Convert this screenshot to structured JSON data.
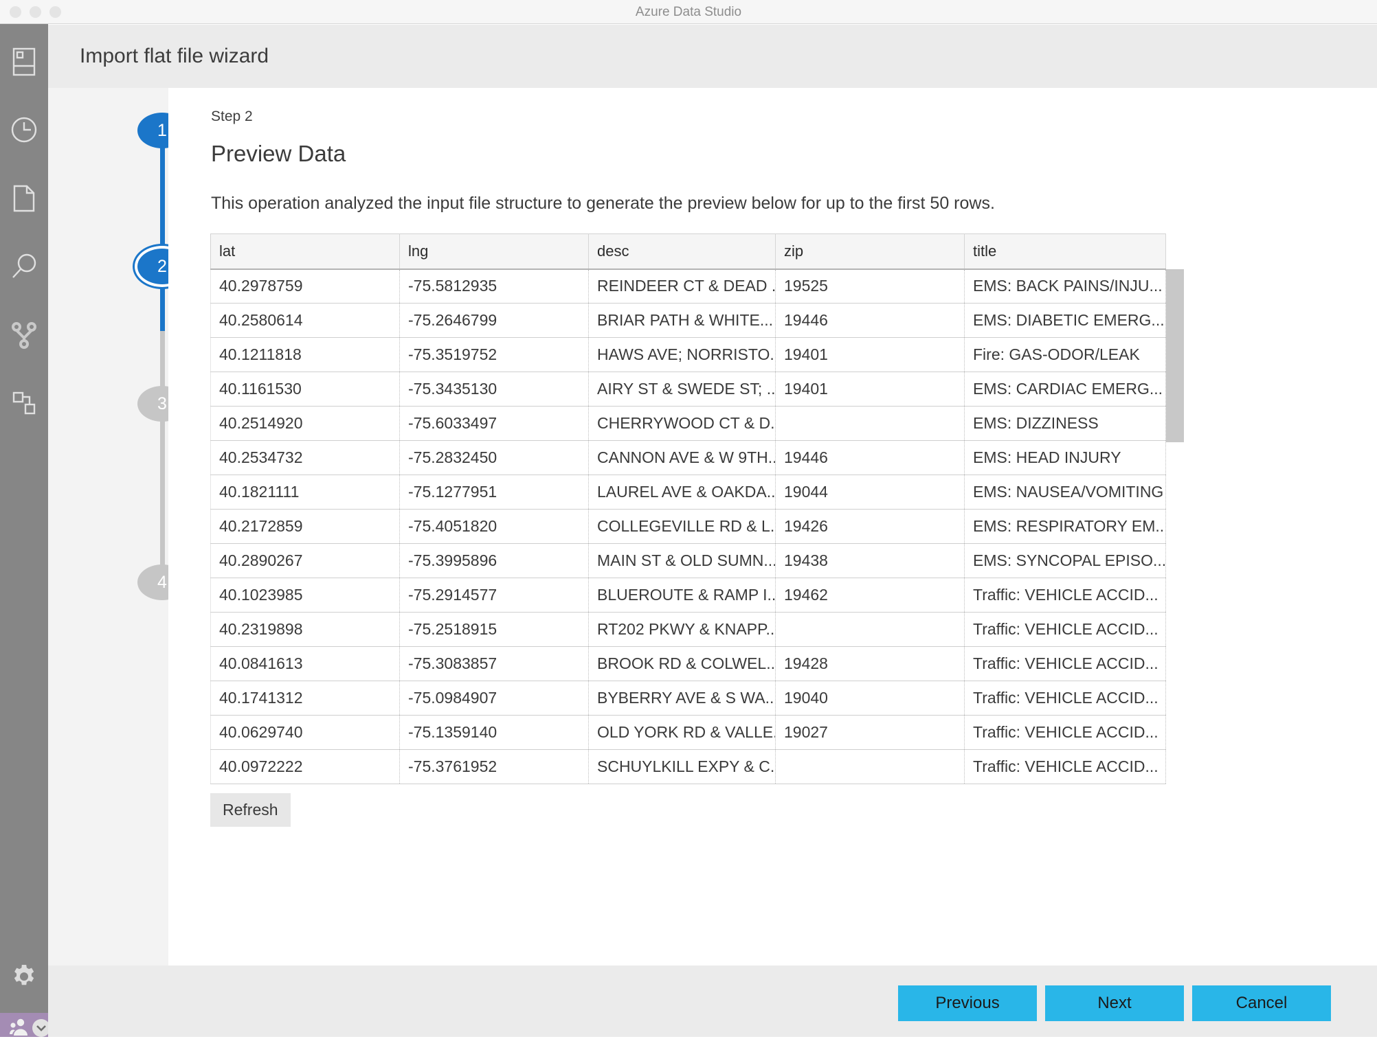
{
  "window": {
    "title": "Azure Data Studio",
    "traffic_lights": [
      "close-button",
      "minimize-button",
      "zoom-button"
    ]
  },
  "activity_bar": {
    "items": [
      {
        "icon": "servers-icon",
        "label": "Servers"
      },
      {
        "icon": "history-clock-icon",
        "label": "History"
      },
      {
        "icon": "file-page-icon",
        "label": "Explorer"
      },
      {
        "icon": "search-magnifier-icon",
        "label": "Search"
      },
      {
        "icon": "source-control-branch-icon",
        "label": "Source Control"
      },
      {
        "icon": "extensions-icon",
        "label": "Extensions"
      }
    ],
    "settings": {
      "icon": "gear-icon",
      "label": "Manage"
    },
    "account": {
      "icon": "accounts-person-icon",
      "badge_icon": "chevron-down-icon"
    }
  },
  "wizard": {
    "title": "Import flat file wizard",
    "steps": [
      {
        "number": "1",
        "state": "done"
      },
      {
        "number": "2",
        "state": "current"
      },
      {
        "number": "3",
        "state": "pending"
      },
      {
        "number": "4",
        "state": "pending"
      }
    ],
    "step_label": "Step 2",
    "heading": "Preview Data",
    "description": "This operation analyzed the input file structure to generate the preview below for up to the first 50 rows.",
    "refresh_label": "Refresh",
    "actions": {
      "previous": "Previous",
      "next": "Next",
      "cancel": "Cancel"
    }
  },
  "preview_table": {
    "columns": [
      "lat",
      "lng",
      "desc",
      "zip",
      "title"
    ],
    "rows": [
      [
        "40.2978759",
        "-75.5812935",
        "REINDEER CT & DEAD ...",
        "19525",
        "EMS: BACK PAINS/INJU..."
      ],
      [
        "40.2580614",
        "-75.2646799",
        "BRIAR PATH & WHITE...",
        "19446",
        "EMS: DIABETIC EMERG..."
      ],
      [
        "40.1211818",
        "-75.3519752",
        "HAWS AVE; NORRISTO...",
        "19401",
        "Fire: GAS-ODOR/LEAK"
      ],
      [
        "40.1161530",
        "-75.3435130",
        "AIRY ST & SWEDE ST; ...",
        "19401",
        "EMS: CARDIAC EMERG..."
      ],
      [
        "40.2514920",
        "-75.6033497",
        "CHERRYWOOD CT & D...",
        "",
        "EMS: DIZZINESS"
      ],
      [
        "40.2534732",
        "-75.2832450",
        "CANNON AVE & W 9TH...",
        "19446",
        "EMS: HEAD INJURY"
      ],
      [
        "40.1821111",
        "-75.1277951",
        "LAUREL AVE & OAKDA...",
        "19044",
        "EMS: NAUSEA/VOMITING"
      ],
      [
        "40.2172859",
        "-75.4051820",
        "COLLEGEVILLE RD & L...",
        "19426",
        "EMS: RESPIRATORY EM..."
      ],
      [
        "40.2890267",
        "-75.3995896",
        "MAIN ST & OLD SUMN...",
        "19438",
        "EMS: SYNCOPAL EPISO..."
      ],
      [
        "40.1023985",
        "-75.2914577",
        "BLUEROUTE & RAMP I...",
        "19462",
        "Traffic: VEHICLE ACCID..."
      ],
      [
        "40.2319898",
        "-75.2518915",
        "RT202 PKWY & KNAPP...",
        "",
        "Traffic: VEHICLE ACCID..."
      ],
      [
        "40.0841613",
        "-75.3083857",
        "BROOK RD & COLWEL...",
        "19428",
        "Traffic: VEHICLE ACCID..."
      ],
      [
        "40.1741312",
        "-75.0984907",
        "BYBERRY AVE & S WA...",
        "19040",
        "Traffic: VEHICLE ACCID..."
      ],
      [
        "40.0629740",
        "-75.1359140",
        "OLD YORK RD & VALLE...",
        "19027",
        "Traffic: VEHICLE ACCID..."
      ],
      [
        "40.0972222",
        "-75.3761952",
        "SCHUYLKILL EXPY & C...",
        "",
        "Traffic: VEHICLE ACCID..."
      ]
    ]
  },
  "colors": {
    "accent_step": "#1b76c9",
    "accent_button": "#29b6e8",
    "activity_bar": "#868686",
    "account_bar": "#a48cb4"
  }
}
